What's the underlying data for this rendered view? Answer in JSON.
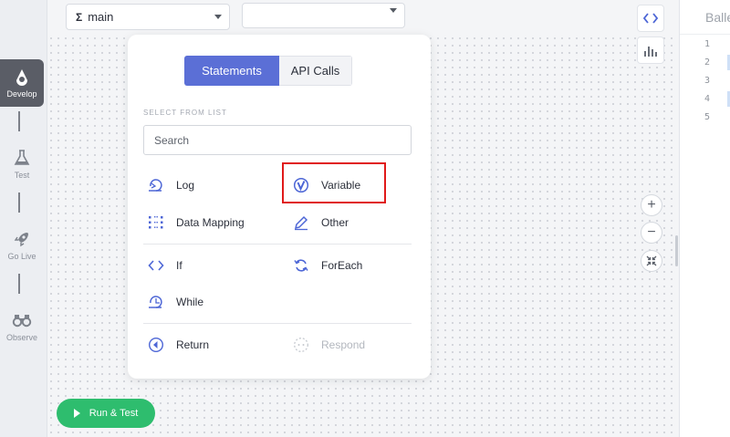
{
  "rail": {
    "items": [
      {
        "label": "Develop",
        "icon": "develop-icon",
        "active": true
      },
      {
        "label": "Test",
        "icon": "flask-icon",
        "active": false
      },
      {
        "label": "Go Live",
        "icon": "rocket-icon",
        "active": false
      },
      {
        "label": "Observe",
        "icon": "binoculars-icon",
        "active": false
      }
    ]
  },
  "topbar": {
    "flow_select": {
      "value": "main",
      "icon": "sigma-icon"
    },
    "second_select": {
      "value": ""
    }
  },
  "popup": {
    "tabs": [
      {
        "label": "Statements",
        "active": true
      },
      {
        "label": "API Calls",
        "active": false
      }
    ],
    "section_label": "SELECT FROM LIST",
    "search": {
      "placeholder": "Search",
      "value": ""
    },
    "options": {
      "log": {
        "label": "Log",
        "icon": "log-icon"
      },
      "variable": {
        "label": "Variable",
        "icon": "variable-icon"
      },
      "data_mapping": {
        "label": "Data Mapping",
        "icon": "data-mapping-icon"
      },
      "other": {
        "label": "Other",
        "icon": "pencil-icon"
      },
      "if": {
        "label": "If",
        "icon": "code-brackets-icon"
      },
      "foreach": {
        "label": "ForEach",
        "icon": "loop-icon"
      },
      "while": {
        "label": "While",
        "icon": "while-icon"
      },
      "return": {
        "label": "Return",
        "icon": "return-icon"
      },
      "respond": {
        "label": "Respond",
        "icon": "respond-icon",
        "disabled": true
      }
    }
  },
  "code_panel": {
    "title": "Balle",
    "lines": [
      "1",
      "2",
      "3",
      "4",
      "5"
    ]
  },
  "tools": {
    "code_view": "code-icon",
    "stats_view": "bar-chart-icon",
    "zoom_in": "+",
    "zoom_out": "−"
  },
  "run_button": {
    "label": "Run & Test"
  },
  "colors": {
    "accent": "#5b6fd6",
    "run_green": "#2ebd6e",
    "highlight_red": "#e01a1a",
    "rail_active": "#5a5d66"
  }
}
